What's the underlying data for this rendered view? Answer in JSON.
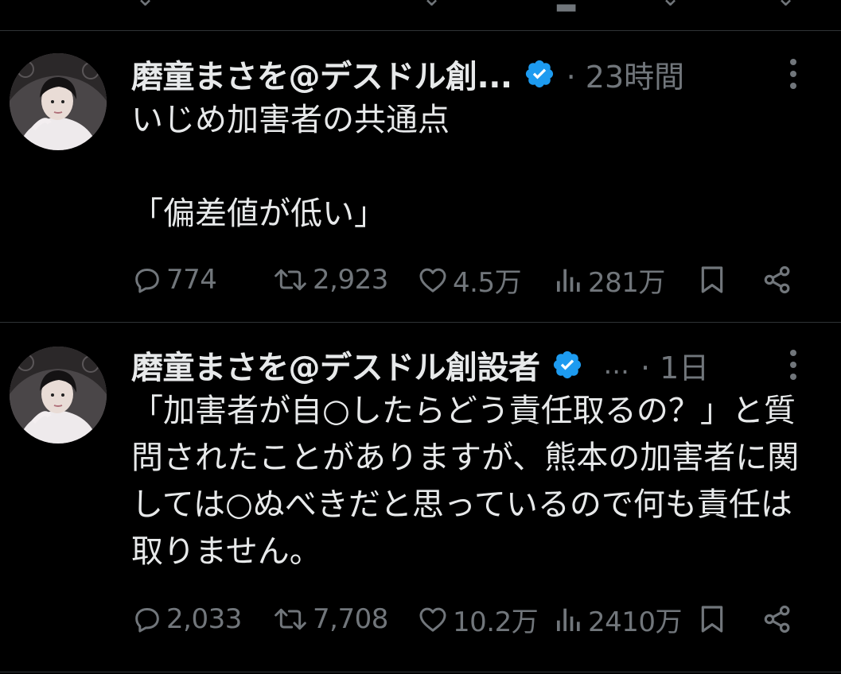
{
  "colors": {
    "background": "#000000",
    "text": "#e7e9ea",
    "muted": "#71767b",
    "divider": "#2f3336",
    "verified_badge": "#1d9bf0"
  },
  "tweets": [
    {
      "author": "磨童まさを@デスドル創...",
      "timestamp": "23時間",
      "text": "いじめ加害者の共通点\n\n「偏差値が低い」",
      "stats": {
        "replies": "774",
        "reposts": "2,923",
        "likes": "4.5万",
        "views": "281万"
      },
      "icons": [
        "reply-icon",
        "repost-icon",
        "like-icon",
        "views-icon",
        "bookmark-icon",
        "share-icon",
        "more-icon",
        "verified-badge-icon"
      ]
    },
    {
      "author": "磨童まさを@デスドル創設者",
      "ellipsis": "...",
      "timestamp": "1日",
      "text": "「加害者が自○したらどう責任取るの？」と質問されたことがありますが、熊本の加害者に関しては○ぬべきだと思っているので何も責任は取りません。",
      "stats": {
        "replies": "2,033",
        "reposts": "7,708",
        "likes": "10.2万",
        "views": "2410万"
      },
      "icons": [
        "reply-icon",
        "repost-icon",
        "like-icon",
        "views-icon",
        "bookmark-icon",
        "share-icon",
        "more-icon",
        "verified-badge-icon"
      ]
    }
  ]
}
